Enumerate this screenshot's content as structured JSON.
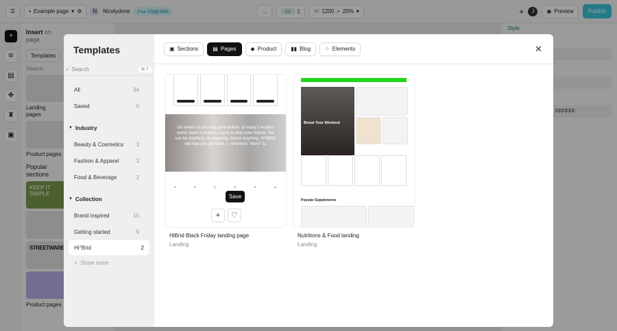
{
  "topbar": {
    "page_name": "Example page",
    "workspace": "Nicelydone",
    "plan": "Free",
    "upgrade": "Upgrade",
    "width_label": "W",
    "width_value": "1200",
    "zoom": "20%",
    "avatar": "J",
    "preview": "Preview",
    "publish": "Publish"
  },
  "left_panel": {
    "title": "Insert",
    "title_suffix": "on page",
    "tab": "Templates",
    "search_placeholder": "Search",
    "labels": [
      "Landing pages",
      "Product pages",
      "Popular sections",
      "Product pages"
    ],
    "thumb_texts": [
      "KEEP IT SIMPLE",
      "STREETWARE"
    ]
  },
  "right_panel": {
    "tab": "Style",
    "color_value": "FFFFFF"
  },
  "modal": {
    "title": "Templates",
    "search_placeholder": "Search",
    "search_shortcut": "⌘ F",
    "top_items": [
      {
        "label": "All",
        "count": "34"
      },
      {
        "label": "Saved",
        "count": "0"
      }
    ],
    "groups": [
      {
        "label": "Industry",
        "items": [
          {
            "label": "Beauty & Cosmetics",
            "count": "3"
          },
          {
            "label": "Fashion & Apparel",
            "count": "3"
          },
          {
            "label": "Food & Beverage",
            "count": "2"
          }
        ]
      },
      {
        "label": "Collection",
        "items": [
          {
            "label": "Brand inspired",
            "count": "15"
          },
          {
            "label": "Getting started",
            "count": "9"
          },
          {
            "label": "Hi°Brid",
            "count": "2"
          }
        ]
      }
    ],
    "show_more": "Show more",
    "tabs": [
      "Sections",
      "Pages",
      "Product",
      "Blog",
      "Elements"
    ],
    "active_tab": "Pages",
    "cards": [
      {
        "title": "HiBrid Black Friday landing page",
        "category": "Landing",
        "preview_quote": "Go where no you has gone before. In today's modern world, there is more to aspire to than ever before. You can be anything, do anything, dream anything. Hi°BRID will help you get there — wherever \"there\" is.",
        "tooltip": "Save"
      },
      {
        "title": "Nutritions & Food landing",
        "category": "Landing",
        "preview_heading": "Boost Your Workout",
        "preview_section": "Popular Supplements"
      }
    ]
  }
}
